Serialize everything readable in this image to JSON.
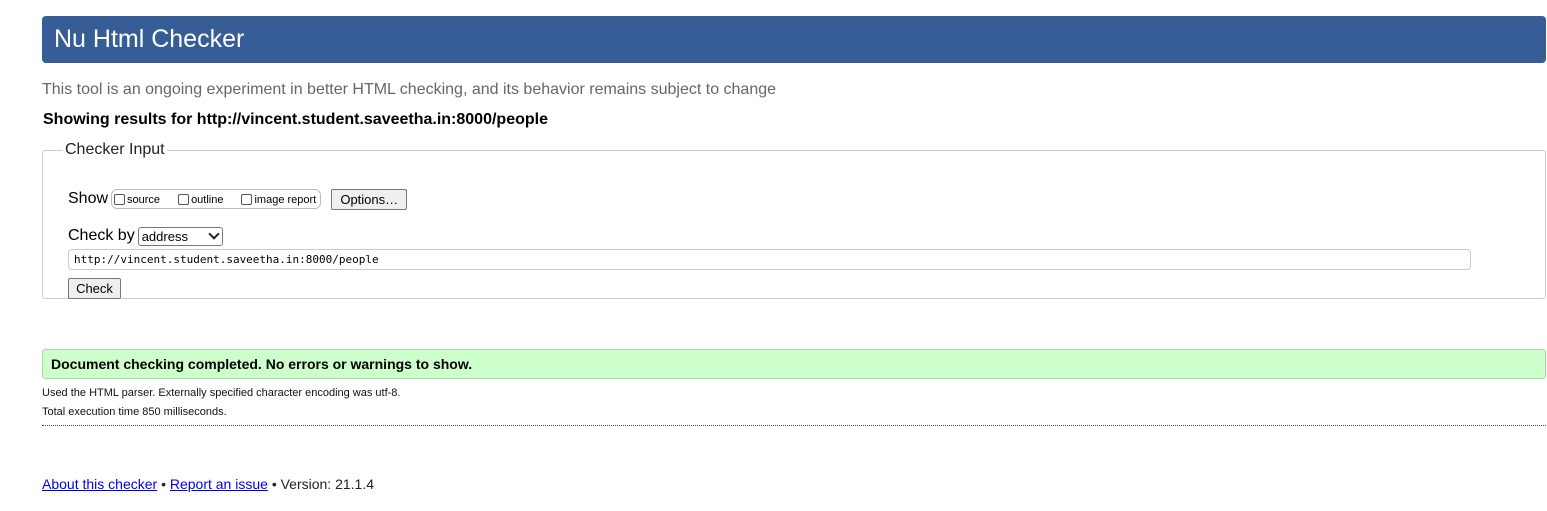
{
  "header": {
    "title": "Nu Html Checker",
    "tagline": "This tool is an ongoing experiment in better HTML checking, and its behavior remains subject to change",
    "results_for": "Showing results for http://vincent.student.saveetha.in:8000/people"
  },
  "checker_input": {
    "legend": "Checker Input",
    "show_label": "Show",
    "show_options": [
      {
        "label": "source",
        "checked": false
      },
      {
        "label": "outline",
        "checked": false
      },
      {
        "label": "image report",
        "checked": false
      }
    ],
    "options_button": "Options…",
    "check_by_label": "Check by",
    "check_by_selected": "address",
    "url_value": "http://vincent.student.saveetha.in:8000/people",
    "check_button": "Check"
  },
  "result": {
    "message": "Document checking completed. No errors or warnings to show.",
    "parser_note": "Used the HTML parser. Externally specified character encoding was utf-8.",
    "execution_time": "Total execution time 850 milliseconds."
  },
  "footer": {
    "about_link": "About this checker",
    "separator": "•",
    "report_link": "Report an issue",
    "version": "Version: 21.1.4"
  },
  "colors": {
    "banner": "#365d95",
    "success_bg": "#ccffcc",
    "link": "#0000ee"
  }
}
